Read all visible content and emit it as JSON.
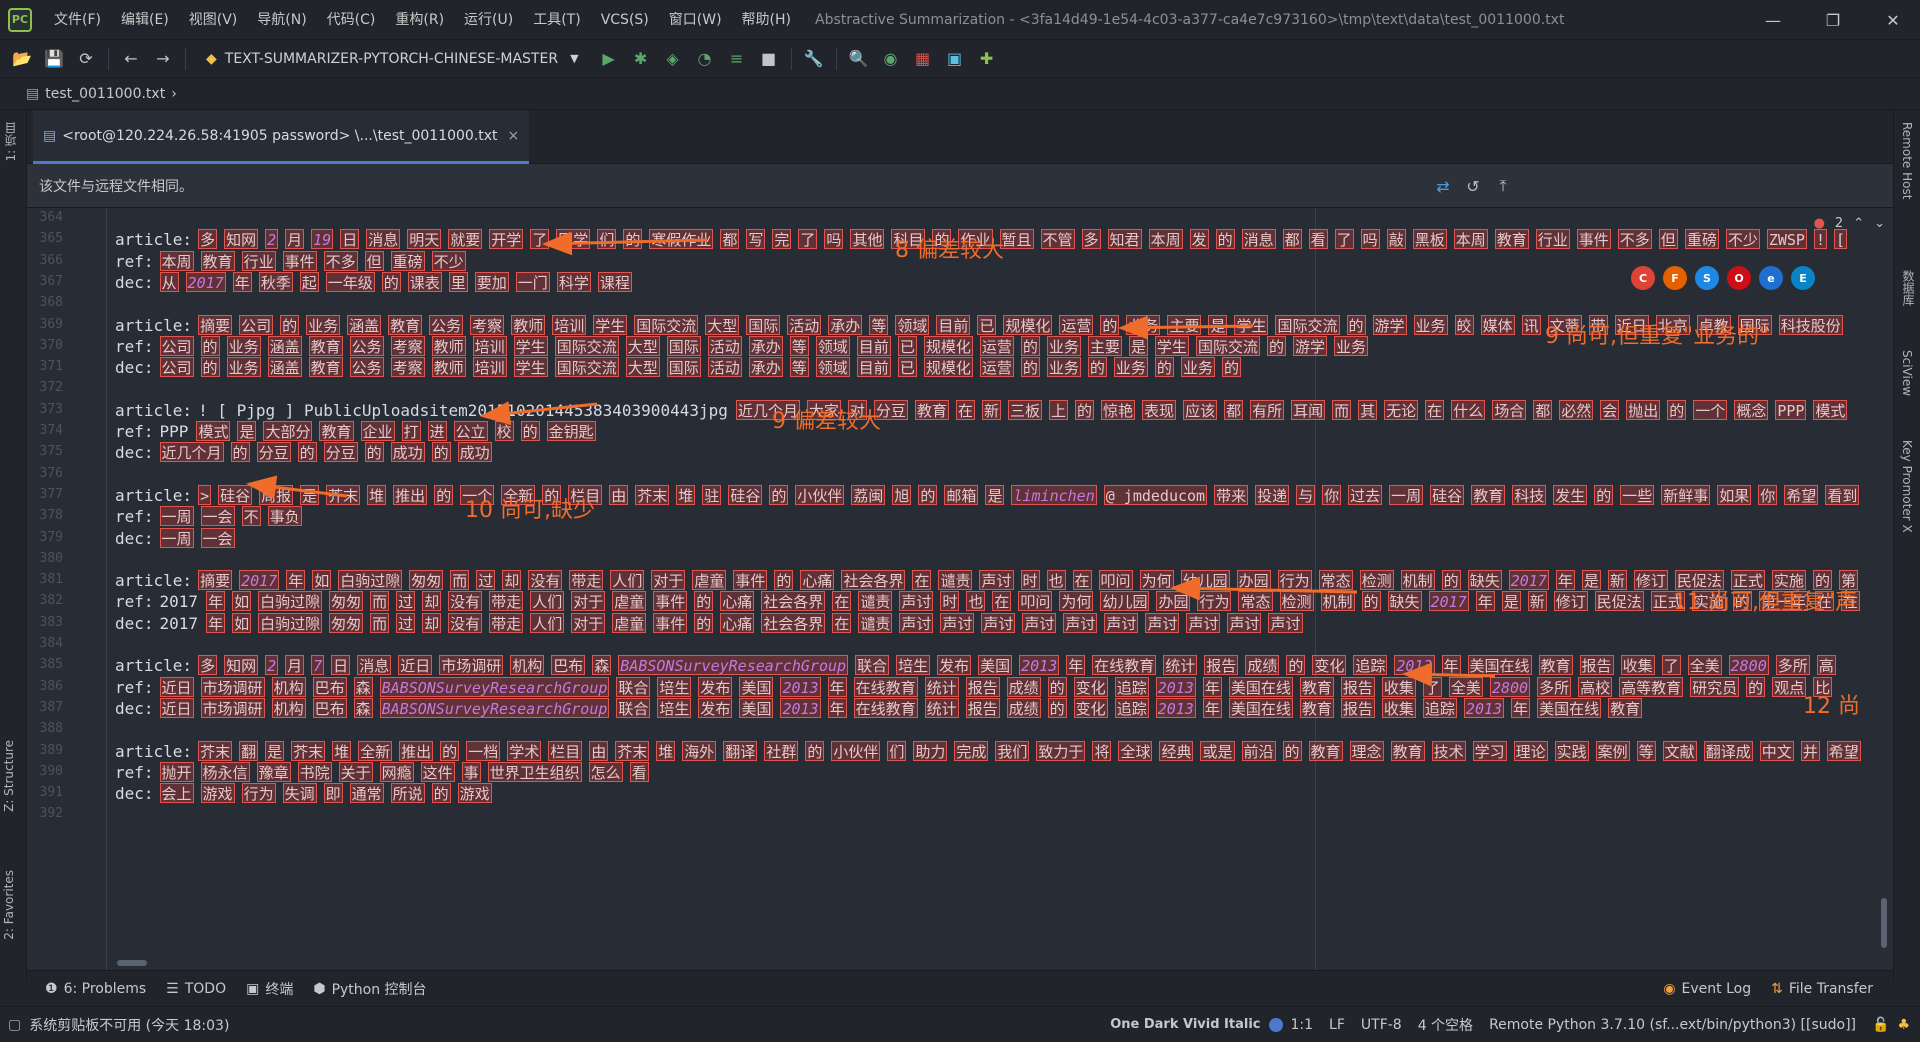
{
  "window": {
    "title": "Abstractive Summarization - <3fa14d49-1e54-4c03-a377-ca4e7c973160>\\tmp\\text\\data\\test_0011000.txt",
    "controls": {
      "minimize": "—",
      "restore": "❐",
      "close": "✕"
    }
  },
  "menu": [
    "文件(F)",
    "编辑(E)",
    "视图(V)",
    "导航(N)",
    "代码(C)",
    "重构(R)",
    "运行(U)",
    "工具(T)",
    "VCS(S)",
    "窗口(W)",
    "帮助(H)"
  ],
  "toolbar": {
    "run_config": "TEXT-SUMMARIZER-PYTORCH-CHINESE-MASTER"
  },
  "breadcrumb": {
    "file": "test_0011000.txt"
  },
  "left_strip": {
    "project": "1: 项目",
    "structure": "Z: Structure",
    "favorites": "2: Favorites"
  },
  "right_strip": {
    "remote_host": "Remote Host",
    "database": "数据库",
    "sciview": "SciView",
    "key_promoter": "Key Promoter X"
  },
  "tab": {
    "label": "<root@120.224.26.58:41905 password> \\...\\test_0011000.txt",
    "close": "×"
  },
  "banner": {
    "message": "该文件与远程文件相同。"
  },
  "inspection": {
    "count": "2"
  },
  "lines": [
    {
      "n": "364",
      "label": "",
      "tokens": []
    },
    {
      "n": "365",
      "label": "article:",
      "tokens": [
        "多",
        "知网",
        "2",
        "月",
        "19",
        "日",
        "消息",
        "明天",
        "就要",
        "开学",
        "了",
        "同学",
        "们",
        "的",
        "寒假作业",
        "都",
        "写",
        "完",
        "了",
        "吗",
        "其他",
        "科目",
        "的",
        "作业",
        "暂且",
        "不管",
        "多",
        "知君",
        "本周",
        "发",
        "的",
        "消息",
        "都",
        "看",
        "了",
        "吗",
        "敲",
        "黑板",
        "本周",
        "教育",
        "行业",
        "事件",
        "不多",
        "但",
        "重磅",
        "不少",
        "ZWSP",
        "!",
        "["
      ]
    },
    {
      "n": "366",
      "label": "ref:",
      "tokens": [
        "本周",
        "教育",
        "行业",
        "事件",
        "不多",
        "但",
        "重磅",
        "不少"
      ]
    },
    {
      "n": "367",
      "label": "dec:",
      "tokens": [
        "从",
        "2017",
        "年",
        "秋季",
        "起",
        "一年级",
        "的",
        "课表",
        "里",
        "要加",
        "一门",
        "科学",
        "课程"
      ]
    },
    {
      "n": "368",
      "label": "",
      "tokens": []
    },
    {
      "n": "369",
      "label": "article:",
      "tokens": [
        "摘要",
        "公司",
        "的",
        "业务",
        "涵盖",
        "教育",
        "公务",
        "考察",
        "教师",
        "培训",
        "学生",
        "国际交流",
        "大型",
        "国际",
        "活动",
        "承办",
        "等",
        "领域",
        "目前",
        "已",
        "规模化",
        "运营",
        "的",
        "业务",
        "主要",
        "是",
        "学生",
        "国际交流",
        "的",
        "游学",
        "业务",
        "皎",
        "媒体",
        "讯",
        "文蒂",
        "带",
        "近日",
        "北京",
        "卓教",
        "国际",
        "科技股份"
      ]
    },
    {
      "n": "370",
      "label": "ref:",
      "tokens": [
        "公司",
        "的",
        "业务",
        "涵盖",
        "教育",
        "公务",
        "考察",
        "教师",
        "培训",
        "学生",
        "国际交流",
        "大型",
        "国际",
        "活动",
        "承办",
        "等",
        "领域",
        "目前",
        "已",
        "规模化",
        "运营",
        "的",
        "业务",
        "主要",
        "是",
        "学生",
        "国际交流",
        "的",
        "游学",
        "业务"
      ]
    },
    {
      "n": "371",
      "label": "dec:",
      "tokens": [
        "公司",
        "的",
        "业务",
        "涵盖",
        "教育",
        "公务",
        "考察",
        "教师",
        "培训",
        "学生",
        "国际交流",
        "大型",
        "国际",
        "活动",
        "承办",
        "等",
        "领域",
        "目前",
        "已",
        "规模化",
        "运营",
        "的",
        "业务",
        "的",
        "业务",
        "的",
        "业务",
        "的"
      ]
    },
    {
      "n": "372",
      "label": "",
      "tokens": []
    },
    {
      "n": "373",
      "label": "article:",
      "plain": "! [ Pjpg ] PublicUploadsitem20151020144538340390044З​jpg",
      "tokens": [
        "近几个月",
        "大家",
        "对",
        "分豆",
        "教育",
        "在",
        "新",
        "三板",
        "上",
        "的",
        "惊艳",
        "表现",
        "应该",
        "都",
        "有所",
        "耳闻",
        "而",
        "其",
        "无论",
        "在",
        "什么",
        "场合",
        "都",
        "必然",
        "会",
        "抛出",
        "的",
        "一个",
        "概念",
        "PPP",
        "模式"
      ]
    },
    {
      "n": "374",
      "label": "ref:",
      "plain": "PPP",
      "tokens": [
        "模式",
        "是",
        "大部分",
        "教育",
        "企业",
        "打",
        "进",
        "公立",
        "校",
        "的",
        "金钥匙"
      ]
    },
    {
      "n": "375",
      "label": "dec:",
      "tokens": [
        "近几个月",
        "的",
        "分豆",
        "的",
        "分豆",
        "的",
        "成功",
        "的",
        "成功"
      ]
    },
    {
      "n": "376",
      "label": "",
      "tokens": []
    },
    {
      "n": "377",
      "label": "article:",
      "tokens": [
        ">",
        "硅谷",
        "周报",
        "是",
        "芥末",
        "堆",
        "推出",
        "的",
        "一个",
        "全新",
        "的",
        "栏目",
        "由",
        "芥末",
        "堆",
        "驻",
        "硅谷",
        "的",
        "小伙伴",
        "荔闽",
        "旭",
        "的",
        "邮箱",
        "是",
        "liminchen",
        "@ jmdeducom",
        "带来",
        "投递",
        "与",
        "你",
        "过去",
        "一周",
        "硅谷",
        "教育",
        "科技",
        "发生",
        "的",
        "一些",
        "新鲜事",
        "如果",
        "你",
        "希望",
        "看到"
      ]
    },
    {
      "n": "378",
      "label": "ref:",
      "tokens": [
        "一周",
        "一会",
        "不",
        "事负"
      ]
    },
    {
      "n": "379",
      "label": "dec:",
      "tokens": [
        "一周",
        "一会"
      ]
    },
    {
      "n": "380",
      "label": "",
      "tokens": []
    },
    {
      "n": "381",
      "label": "article:",
      "tokens": [
        "摘要",
        "2017",
        "年",
        "如",
        "白驹过隙",
        "匆匆",
        "而",
        "过",
        "却",
        "没有",
        "带走",
        "人们",
        "对于",
        "虐童",
        "事件",
        "的",
        "心痛",
        "社会各界",
        "在",
        "谴责",
        "声讨",
        "时",
        "也",
        "在",
        "叩问",
        "为何",
        "幼儿园",
        "办园",
        "行为",
        "常态",
        "检测",
        "机制",
        "的",
        "缺失",
        "2017",
        "年",
        "是",
        "新",
        "修订",
        "民促法",
        "正式",
        "实施",
        "的",
        "第"
      ]
    },
    {
      "n": "382",
      "label": "ref:",
      "plain": "2017",
      "tokens": [
        "年",
        "如",
        "白驹过隙",
        "匆匆",
        "而",
        "过",
        "却",
        "没有",
        "带走",
        "人们",
        "对于",
        "虐童",
        "事件",
        "的",
        "心痛",
        "社会各界",
        "在",
        "谴责",
        "声讨",
        "时",
        "也",
        "在",
        "叩问",
        "为何",
        "幼儿园",
        "办园",
        "行为",
        "常态",
        "检测",
        "机制",
        "的",
        "缺失",
        "2017",
        "年",
        "是",
        "新",
        "修订",
        "民促法",
        "正式",
        "实施",
        "的",
        "第一年",
        "在",
        "在"
      ]
    },
    {
      "n": "383",
      "label": "dec:",
      "plain": "2017",
      "tokens": [
        "年",
        "如",
        "白驹过隙",
        "匆匆",
        "而",
        "过",
        "却",
        "没有",
        "带走",
        "人们",
        "对于",
        "虐童",
        "事件",
        "的",
        "心痛",
        "社会各界",
        "在",
        "谴责",
        "声讨",
        "声讨",
        "声讨",
        "声讨",
        "声讨",
        "声讨",
        "声讨",
        "声讨",
        "声讨",
        "声讨"
      ]
    },
    {
      "n": "384",
      "label": "",
      "tokens": []
    },
    {
      "n": "385",
      "label": "article:",
      "tokens": [
        "多",
        "知网",
        "2",
        "月",
        "7",
        "日",
        "消息",
        "近日",
        "市场调研",
        "机构",
        "巴布",
        "森",
        "BABSONSurveyResearchGroup",
        "联合",
        "培生",
        "发布",
        "美国",
        "2013",
        "年",
        "在线教育",
        "统计",
        "报告",
        "成绩",
        "的",
        "变化",
        "追踪",
        "2013",
        "年",
        "美国在线",
        "教育",
        "报告",
        "收集",
        "了",
        "全美",
        "2800",
        "多所",
        "高"
      ]
    },
    {
      "n": "386",
      "label": "ref:",
      "tokens": [
        "近日",
        "市场调研",
        "机构",
        "巴布",
        "森",
        "BABSONSurveyResearchGroup",
        "联合",
        "培生",
        "发布",
        "美国",
        "2013",
        "年",
        "在线教育",
        "统计",
        "报告",
        "成绩",
        "的",
        "变化",
        "追踪",
        "2013",
        "年",
        "美国在线",
        "教育",
        "报告",
        "收集",
        "了",
        "全美",
        "2800",
        "多所",
        "高校",
        "高等教育",
        "研究员",
        "的",
        "观点",
        "比"
      ]
    },
    {
      "n": "387",
      "label": "dec:",
      "tokens": [
        "近日",
        "市场调研",
        "机构",
        "巴布",
        "森",
        "BABSONSurveyResearchGroup",
        "联合",
        "培生",
        "发布",
        "美国",
        "2013",
        "年",
        "在线教育",
        "统计",
        "报告",
        "成绩",
        "的",
        "变化",
        "追踪",
        "2013",
        "年",
        "美国在线",
        "教育",
        "报告",
        "收集",
        "追踪",
        "2013",
        "年",
        "美国在线",
        "教育"
      ]
    },
    {
      "n": "388",
      "label": "",
      "tokens": []
    },
    {
      "n": "389",
      "label": "article:",
      "tokens": [
        "芥末",
        "翻",
        "是",
        "芥末",
        "堆",
        "全新",
        "推出",
        "的",
        "一档",
        "学术",
        "栏目",
        "由",
        "芥末",
        "堆",
        "海外",
        "翻译",
        "社群",
        "的",
        "小伙伴",
        "们",
        "助力",
        "完成",
        "我们",
        "致力于",
        "将",
        "全球",
        "经典",
        "或是",
        "前沿",
        "的",
        "教育",
        "理念",
        "教育",
        "技术",
        "学习",
        "理论",
        "实践",
        "案例",
        "等",
        "文献",
        "翻译成",
        "中文",
        "并",
        "希望"
      ]
    },
    {
      "n": "390",
      "label": "ref:",
      "tokens": [
        "抛开",
        "杨永信",
        "豫章",
        "书院",
        "关于",
        "网瘾",
        "这件",
        "事",
        "世界卫生组织",
        "怎么",
        "看"
      ]
    },
    {
      "n": "391",
      "label": "dec:",
      "tokens": [
        "会上",
        "游戏",
        "行为",
        "失调",
        "即",
        "通常",
        "所说",
        "的",
        "游戏"
      ]
    },
    {
      "n": "392",
      "label": "",
      "tokens": []
    }
  ],
  "annotations": [
    {
      "id": "a8",
      "text": "8 偏差较大"
    },
    {
      "id": "a9",
      "text": "9 尚可,但重复\"业务的\""
    },
    {
      "id": "a9b",
      "text": "9 偏差较大"
    },
    {
      "id": "a10",
      "text": "10 尚可,缺少"
    },
    {
      "id": "a11",
      "text": "11 尚可,但重复\"声"
    },
    {
      "id": "a12",
      "text": "12 尚"
    }
  ],
  "tool_windows": [
    {
      "icon": "❶",
      "label": "6: Problems"
    },
    {
      "icon": "☰",
      "label": "TODO"
    },
    {
      "icon": "▣",
      "label": "终端"
    },
    {
      "icon": "⬢",
      "label": "Python 控制台"
    }
  ],
  "tool_windows_right": [
    {
      "icon": "◉",
      "label": "Event Log"
    },
    {
      "icon": "⇅",
      "label": "File Transfer"
    }
  ],
  "status": {
    "left": "系统剪贴板不可用 (今天 18:03)",
    "theme": "One Dark Vivid Italic",
    "position": "1:1",
    "line_sep": "LF",
    "encoding": "UTF-8",
    "indent": "4 个空格",
    "interpreter": "Remote Python 3.7.10 (sf...ext/bin/python3) [[sudo]]"
  },
  "colors": {
    "accent": "#4d78cc",
    "annotation": "#ef6c2a",
    "token_border": "#e0564f",
    "number": "#c678dd"
  }
}
